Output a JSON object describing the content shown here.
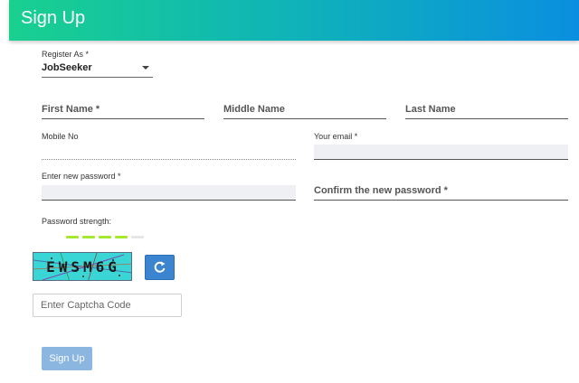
{
  "header": {
    "title": "Sign Up"
  },
  "register": {
    "label": "Register As *",
    "value": "JobSeeker"
  },
  "fields": {
    "first_name": "First Name *",
    "middle_name": "Middle Name",
    "last_name": "Last Name",
    "mobile": "Mobile No",
    "email": "Your email *",
    "new_password": "Enter new password *",
    "confirm_password": "Confirm the new password *"
  },
  "password_strength": {
    "label": "Password strength:",
    "level": 0.8,
    "segments": 5,
    "colors": [
      "#a6e82e",
      "#e6e6e6"
    ]
  },
  "captcha": {
    "text": "EWSM6G",
    "input_placeholder": "Enter Captcha Code"
  },
  "submit": {
    "label": "Sign Up"
  },
  "colors": {
    "header_start": "#19d08f",
    "header_end": "#0a8fe0",
    "refresh_button": "#3a84d0",
    "submit_button": "#8ab6e0"
  },
  "icons": {
    "refresh": "refresh-icon",
    "dropdown": "chevron-down-icon"
  }
}
